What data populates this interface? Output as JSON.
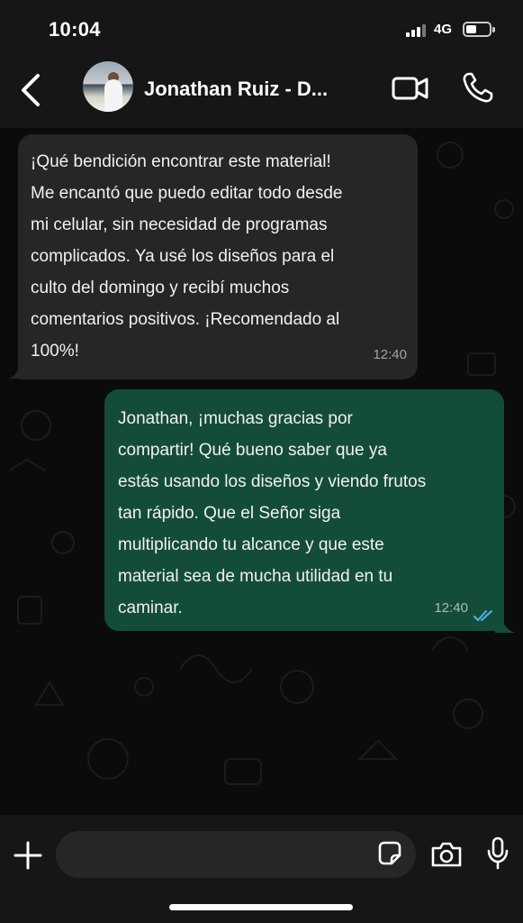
{
  "status_bar": {
    "time": "10:04",
    "network": "4G",
    "battery_level": 0.45
  },
  "header": {
    "back_icon": "chevron-left-icon",
    "contact_name": "Jonathan Ruiz - D...",
    "video_icon": "video-camera-icon",
    "call_icon": "phone-icon"
  },
  "messages": [
    {
      "direction": "incoming",
      "lines": [
        "¡Qué bendición encontrar este material!",
        "Me encantó que puedo editar todo desde",
        "mi celular, sin necesidad de programas",
        "complicados. Ya usé los diseños para el",
        "culto del domingo y recibí muchos",
        "comentarios positivos. ¡Recomendado al",
        "100%!"
      ],
      "time": "12:40"
    },
    {
      "direction": "outgoing",
      "lines": [
        "Jonathan, ¡muchas gracias por",
        "compartir! Qué bueno saber que ya",
        "estás usando los diseños y viendo frutos",
        "tan rápido. Que el Señor siga",
        "multiplicando tu alcance y que este",
        "material sea de mucha utilidad en tu",
        "caminar."
      ],
      "time": "12:40",
      "read_icon": "double-check-icon"
    }
  ],
  "input_bar": {
    "plus_icon": "plus-icon",
    "placeholder": "",
    "sticker_icon": "sticker-icon",
    "camera_icon": "camera-icon",
    "mic_icon": "microphone-icon"
  },
  "colors": {
    "incoming_bubble": "#262626",
    "outgoing_bubble": "#144d37",
    "read_ticks": "#4fb3ea",
    "bars": "#161616"
  }
}
